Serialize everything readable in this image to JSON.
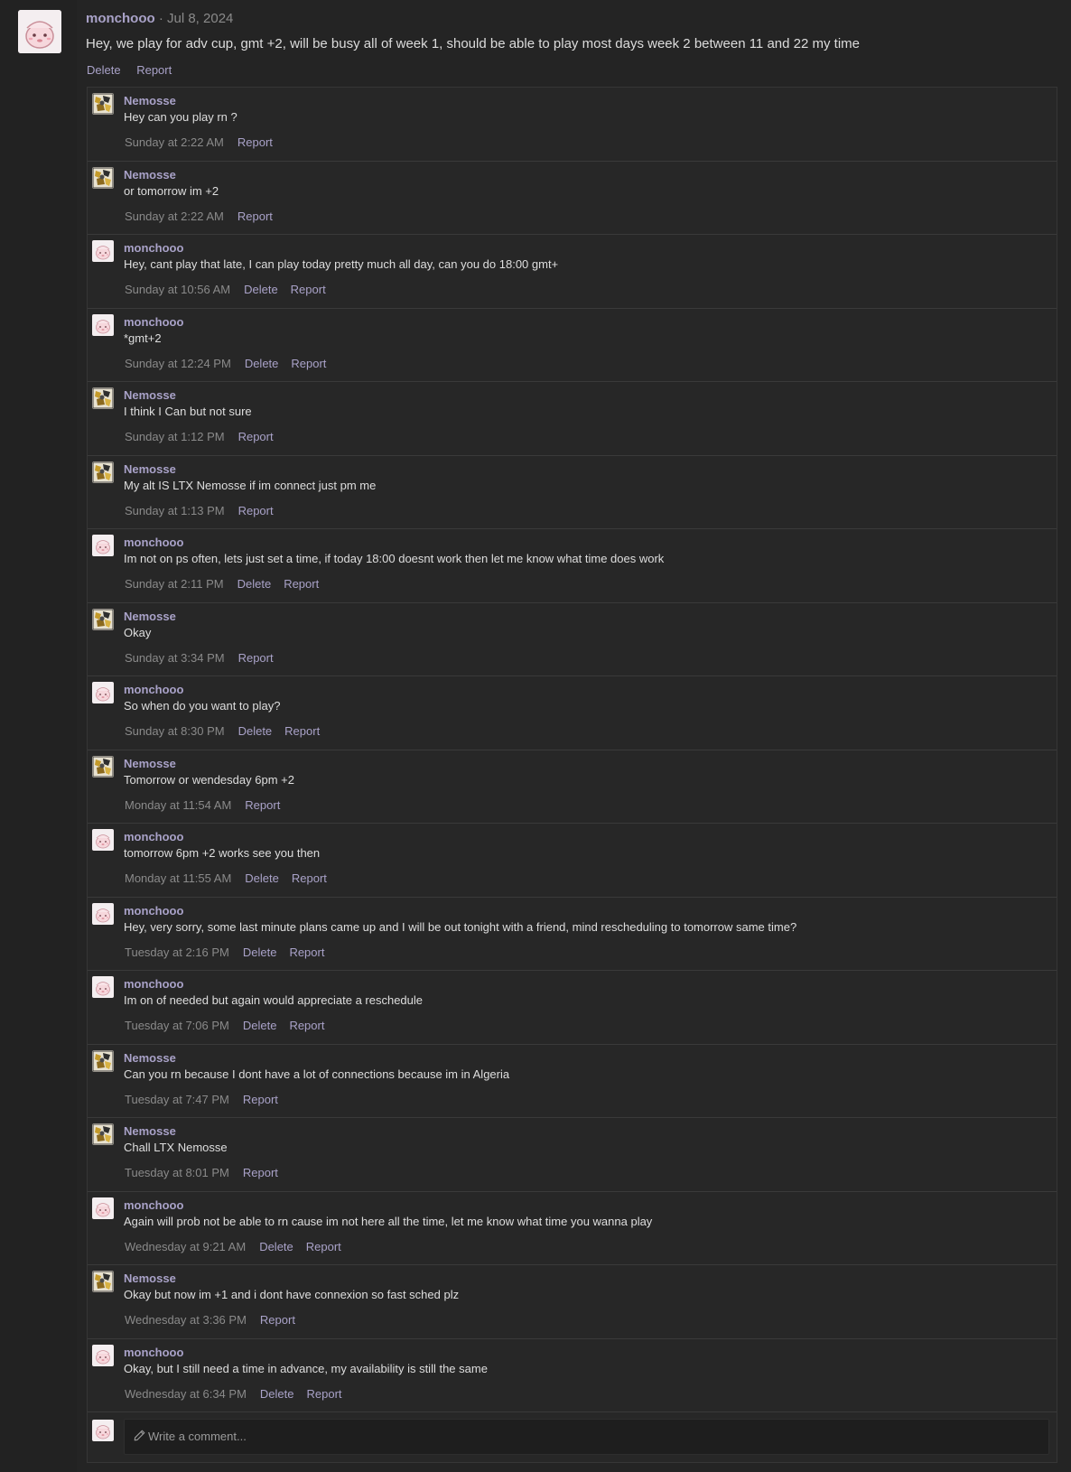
{
  "post": {
    "author": "monchooo",
    "separator": "·",
    "date": "Jul 8, 2024",
    "body": "Hey, we play for adv cup, gmt +2, will be busy all of week 1, should be able to play most days week 2 between 11 and 22 my time",
    "delete_label": "Delete",
    "report_label": "Report"
  },
  "comments": [
    {
      "author": "Nemosse",
      "text": "Hey can you play rn ?",
      "time": "Sunday at 2:22 AM",
      "delete": "",
      "report": "Report"
    },
    {
      "author": "Nemosse",
      "text": "or tomorrow im +2",
      "time": "Sunday at 2:22 AM",
      "delete": "",
      "report": "Report"
    },
    {
      "author": "monchooo",
      "text": "Hey, cant play that late, I can play today pretty much all day, can you do 18:00 gmt+",
      "time": "Sunday at 10:56 AM",
      "delete": "Delete",
      "report": "Report"
    },
    {
      "author": "monchooo",
      "text": "*gmt+2",
      "time": "Sunday at 12:24 PM",
      "delete": "Delete",
      "report": "Report"
    },
    {
      "author": "Nemosse",
      "text": "I think I Can but not sure",
      "time": "Sunday at 1:12 PM",
      "delete": "",
      "report": "Report"
    },
    {
      "author": "Nemosse",
      "text": "My alt IS LTX Nemosse if im connect just pm me",
      "time": "Sunday at 1:13 PM",
      "delete": "",
      "report": "Report"
    },
    {
      "author": "monchooo",
      "text": "Im not on ps often, lets just set a time, if today 18:00 doesnt work then let me know what time does work",
      "time": "Sunday at 2:11 PM",
      "delete": "Delete",
      "report": "Report"
    },
    {
      "author": "Nemosse",
      "text": "Okay",
      "time": "Sunday at 3:34 PM",
      "delete": "",
      "report": "Report"
    },
    {
      "author": "monchooo",
      "text": "So when do you want to play?",
      "time": "Sunday at 8:30 PM",
      "delete": "Delete",
      "report": "Report"
    },
    {
      "author": "Nemosse",
      "text": "Tomorrow or wendesday 6pm +2",
      "time": "Monday at 11:54 AM",
      "delete": "",
      "report": "Report"
    },
    {
      "author": "monchooo",
      "text": "tomorrow 6pm +2 works see you then",
      "time": "Monday at 11:55 AM",
      "delete": "Delete",
      "report": "Report"
    },
    {
      "author": "monchooo",
      "text": "Hey, very sorry, some last minute plans came up and I will be out tonight with a friend, mind rescheduling to tomorrow same time?",
      "time": "Tuesday at 2:16 PM",
      "delete": "Delete",
      "report": "Report"
    },
    {
      "author": "monchooo",
      "text": "Im on of needed but again would appreciate a reschedule",
      "time": "Tuesday at 7:06 PM",
      "delete": "Delete",
      "report": "Report"
    },
    {
      "author": "Nemosse",
      "text": "Can you rn because I dont have a lot of connections because im in Algeria",
      "time": "Tuesday at 7:47 PM",
      "delete": "",
      "report": "Report"
    },
    {
      "author": "Nemosse",
      "text": "Chall LTX Nemosse",
      "time": "Tuesday at 8:01 PM",
      "delete": "",
      "report": "Report"
    },
    {
      "author": "monchooo",
      "text": "Again will prob not be able to rn cause im not here all the time, let me know what time you wanna play",
      "time": "Wednesday at 9:21 AM",
      "delete": "Delete",
      "report": "Report"
    },
    {
      "author": "Nemosse",
      "text": "Okay but now im +1 and i dont have connexion so fast sched plz",
      "time": "Wednesday at 3:36 PM",
      "delete": "",
      "report": "Report"
    },
    {
      "author": "monchooo",
      "text": "Okay, but I still need a time in advance, my availability is still the same",
      "time": "Wednesday at 6:34 PM",
      "delete": "Delete",
      "report": "Report"
    }
  ],
  "composer": {
    "placeholder": "Write a comment..."
  },
  "colors": {
    "link": "#a9a2c8",
    "muted": "#8a8a8a",
    "background": "#1c1c1c",
    "panel": "#242424"
  }
}
